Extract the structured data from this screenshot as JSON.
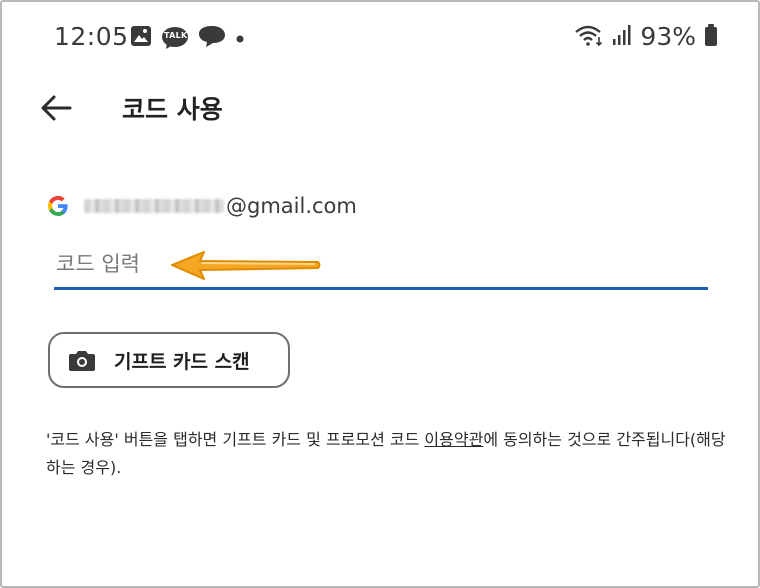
{
  "status_bar": {
    "time": "12:05",
    "battery": "93%",
    "left_icons": [
      "gallery-icon",
      "kakaotalk-icon",
      "chat-bubble-icon",
      "dot-icon"
    ],
    "right_icons": [
      "wifi-icon",
      "signal-icon",
      "battery-icon"
    ],
    "talk_badge": "TALK"
  },
  "app_bar": {
    "back_icon": "arrow-left-icon",
    "title": "코드 사용"
  },
  "account": {
    "email_domain": "@gmail.com"
  },
  "code_input": {
    "placeholder": "코드 입력",
    "value": "",
    "underline_color": "#1a5fb4"
  },
  "annotation": {
    "arrow_color": "#f5a623"
  },
  "scan_button": {
    "label": "기프트 카드 스캔",
    "icon": "camera-icon"
  },
  "terms": {
    "before": "'코드 사용' 버튼을 탭하면 기프트 카드 및 프로모션 코드 ",
    "link": "이용약관",
    "after": "에 동의하는 것으로 간주됩니다(해당하는 경우)."
  }
}
